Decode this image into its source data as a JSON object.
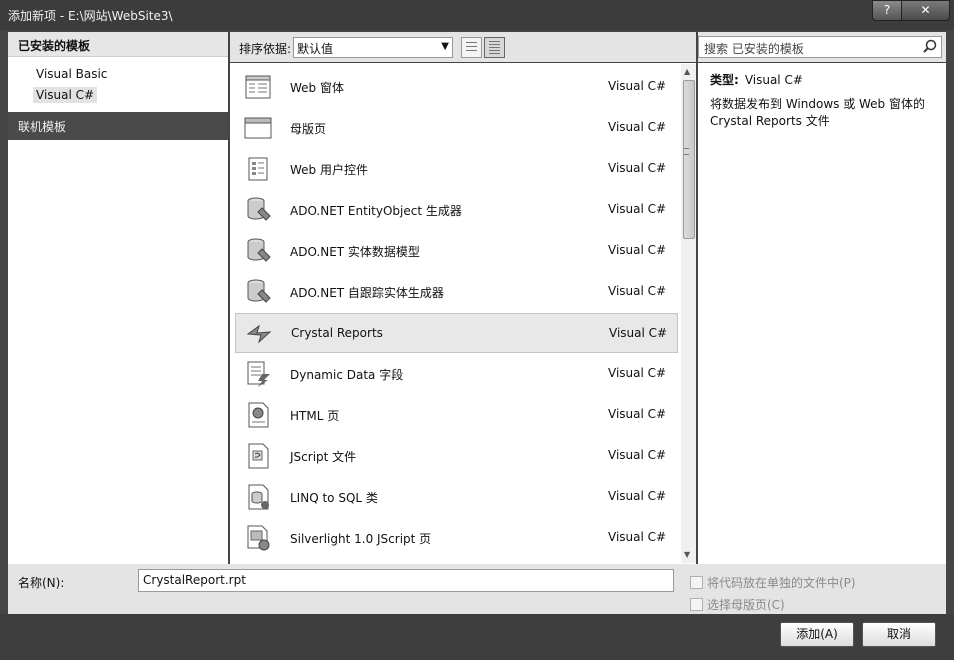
{
  "window": {
    "title": "添加新项 - E:\\网站\\WebSite3\\",
    "help_label": "?",
    "close_label": "✕"
  },
  "sidebar": {
    "installed_header": "已安装的模板",
    "items": [
      {
        "label": "Visual Basic",
        "selected": false
      },
      {
        "label": "Visual C#",
        "selected": true
      }
    ],
    "online_header": "联机模板"
  },
  "sort": {
    "label": "排序依据:",
    "selected": "默认值"
  },
  "search": {
    "placeholder": "搜索 已安装的模板"
  },
  "templates": [
    {
      "name": "Web 窗体",
      "language": "Visual C#",
      "icon": "web-form-icon",
      "selected": false
    },
    {
      "name": "母版页",
      "language": "Visual C#",
      "icon": "master-page-icon",
      "selected": false
    },
    {
      "name": "Web 用户控件",
      "language": "Visual C#",
      "icon": "user-control-icon",
      "selected": false
    },
    {
      "name": "ADO.NET EntityObject 生成器",
      "language": "Visual C#",
      "icon": "database-icon",
      "selected": false
    },
    {
      "name": "ADO.NET 实体数据模型",
      "language": "Visual C#",
      "icon": "database-icon",
      "selected": false
    },
    {
      "name": "ADO.NET 自跟踪实体生成器",
      "language": "Visual C#",
      "icon": "database-icon",
      "selected": false
    },
    {
      "name": "Crystal Reports",
      "language": "Visual C#",
      "icon": "crystal-reports-icon",
      "selected": true
    },
    {
      "name": "Dynamic Data 字段",
      "language": "Visual C#",
      "icon": "dynamic-data-icon",
      "selected": false
    },
    {
      "name": "HTML 页",
      "language": "Visual C#",
      "icon": "html-page-icon",
      "selected": false
    },
    {
      "name": "JScript 文件",
      "language": "Visual C#",
      "icon": "jscript-file-icon",
      "selected": false
    },
    {
      "name": "LINQ to SQL 类",
      "language": "Visual C#",
      "icon": "linq-to-sql-icon",
      "selected": false
    },
    {
      "name": "Silverlight 1.0 JScript 页",
      "language": "Visual C#",
      "icon": "silverlight-icon",
      "selected": false
    }
  ],
  "description": {
    "type_label": "类型:",
    "type_value": "Visual C#",
    "text": "将数据发布到 Windows 或 Web 窗体的 Crystal Reports 文件"
  },
  "bottom": {
    "name_label": "名称(N):",
    "name_value": "CrystalReport.rpt",
    "checkbox_separate": "将代码放在单独的文件中(P)",
    "checkbox_master": "选择母版页(C)"
  },
  "buttons": {
    "add": "添加(A)",
    "cancel": "取消"
  }
}
